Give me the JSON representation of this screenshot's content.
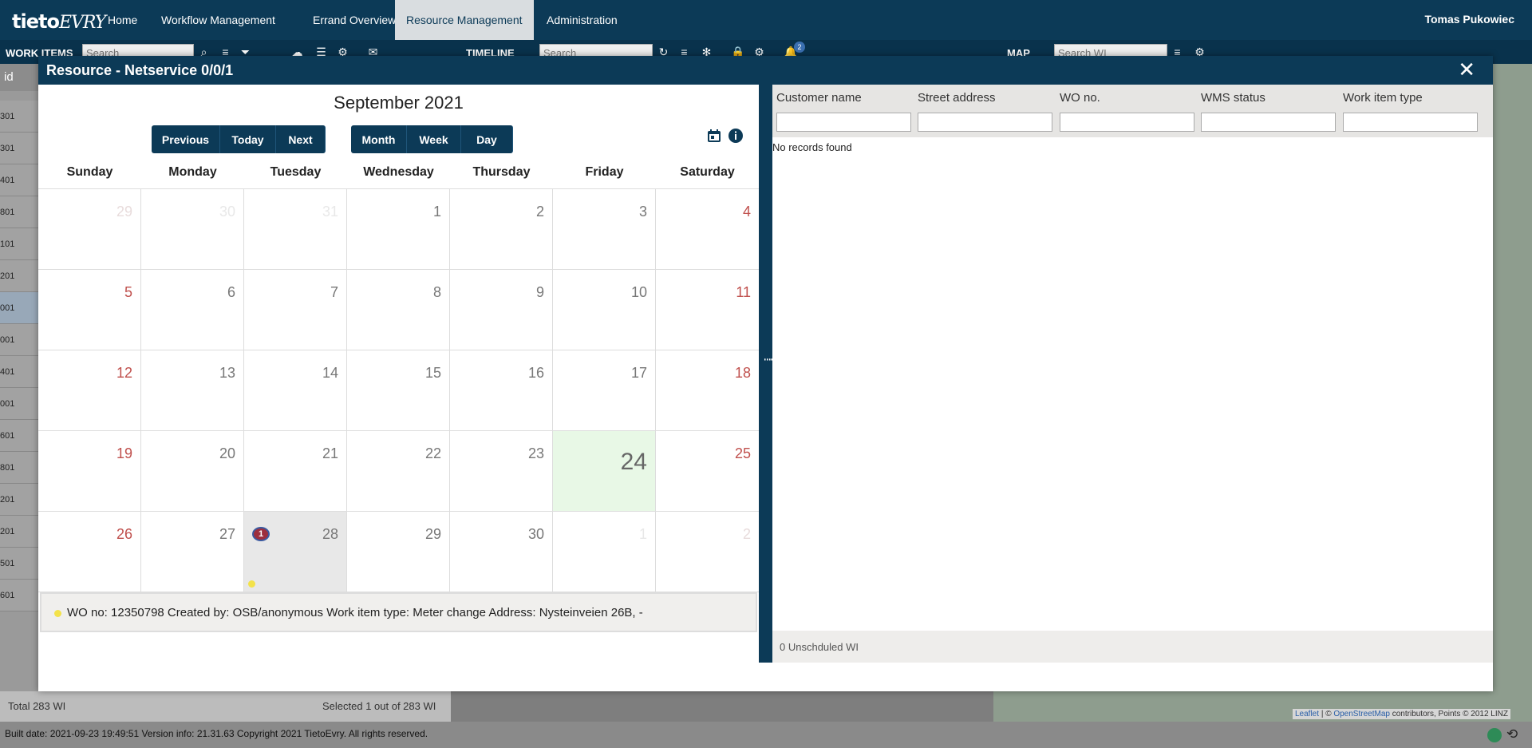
{
  "nav": {
    "logo_main": "tieto",
    "logo_sub": "EVRY",
    "items": [
      "Home",
      "Workflow Management",
      "Errand Overview",
      "Resource Management",
      "Administration"
    ],
    "active_index": 3,
    "user": "Tomas Pukowiec"
  },
  "toolbar": {
    "work_items_label": "WORK ITEMS",
    "work_items_placeholder": "Search",
    "timeline_label": "TIMELINE",
    "timeline_placeholder": "Search",
    "map_label": "MAP",
    "map_placeholder": "Search WI",
    "notification_count": "2"
  },
  "left_panel": {
    "col_header": "id",
    "rows": [
      "301",
      "301",
      "401",
      "801",
      "101",
      "201",
      "001",
      "001",
      "401",
      "001",
      "601",
      "801",
      "201",
      "201",
      "501",
      "601"
    ],
    "selected_row": 6,
    "total": "Total 283 WI",
    "selected": "Selected 1 out of 283 WI"
  },
  "map_attribution": {
    "leaflet": "Leaflet",
    "osm": "OpenStreetMap",
    "rest": "contributors, Points © 2012 LINZ",
    "sep": "|  ©"
  },
  "footer": {
    "build": "Built date: 2021-09-23 19:49:51 Version info: 21.31.63 Copyright 2021 TietoEvry. All rights reserved."
  },
  "modal": {
    "title": "Resource - Netservice  0/0/1",
    "close": "✕",
    "calendar": {
      "month_title": "September 2021",
      "nav_buttons": [
        "Previous",
        "Today",
        "Next"
      ],
      "view_buttons": [
        "Month",
        "Week",
        "Day"
      ],
      "weekdays": [
        "Sunday",
        "Monday",
        "Tuesday",
        "Wednesday",
        "Thursday",
        "Friday",
        "Saturday"
      ],
      "weeks": [
        [
          "29",
          "30",
          "31",
          "1",
          "2",
          "3",
          "4"
        ],
        [
          "5",
          "6",
          "7",
          "8",
          "9",
          "10",
          "11"
        ],
        [
          "12",
          "13",
          "14",
          "15",
          "16",
          "17",
          "18"
        ],
        [
          "19",
          "20",
          "21",
          "22",
          "23",
          "24",
          "25"
        ],
        [
          "26",
          "27",
          "28",
          "29",
          "30",
          "1",
          "2"
        ]
      ],
      "today": "24",
      "event_day": "28",
      "event_badge": "1",
      "event_info": "WO no: 12350798 Created by: OSB/anonymous Work item type: Meter change Address: Nysteinveien 26B, -",
      "event_color": "#f3e24a"
    },
    "table": {
      "columns": [
        "Customer name",
        "Street address",
        "WO no.",
        "WMS status",
        "Work item type"
      ],
      "empty_text": "No records found",
      "footer": "0 Unschduled WI"
    }
  }
}
